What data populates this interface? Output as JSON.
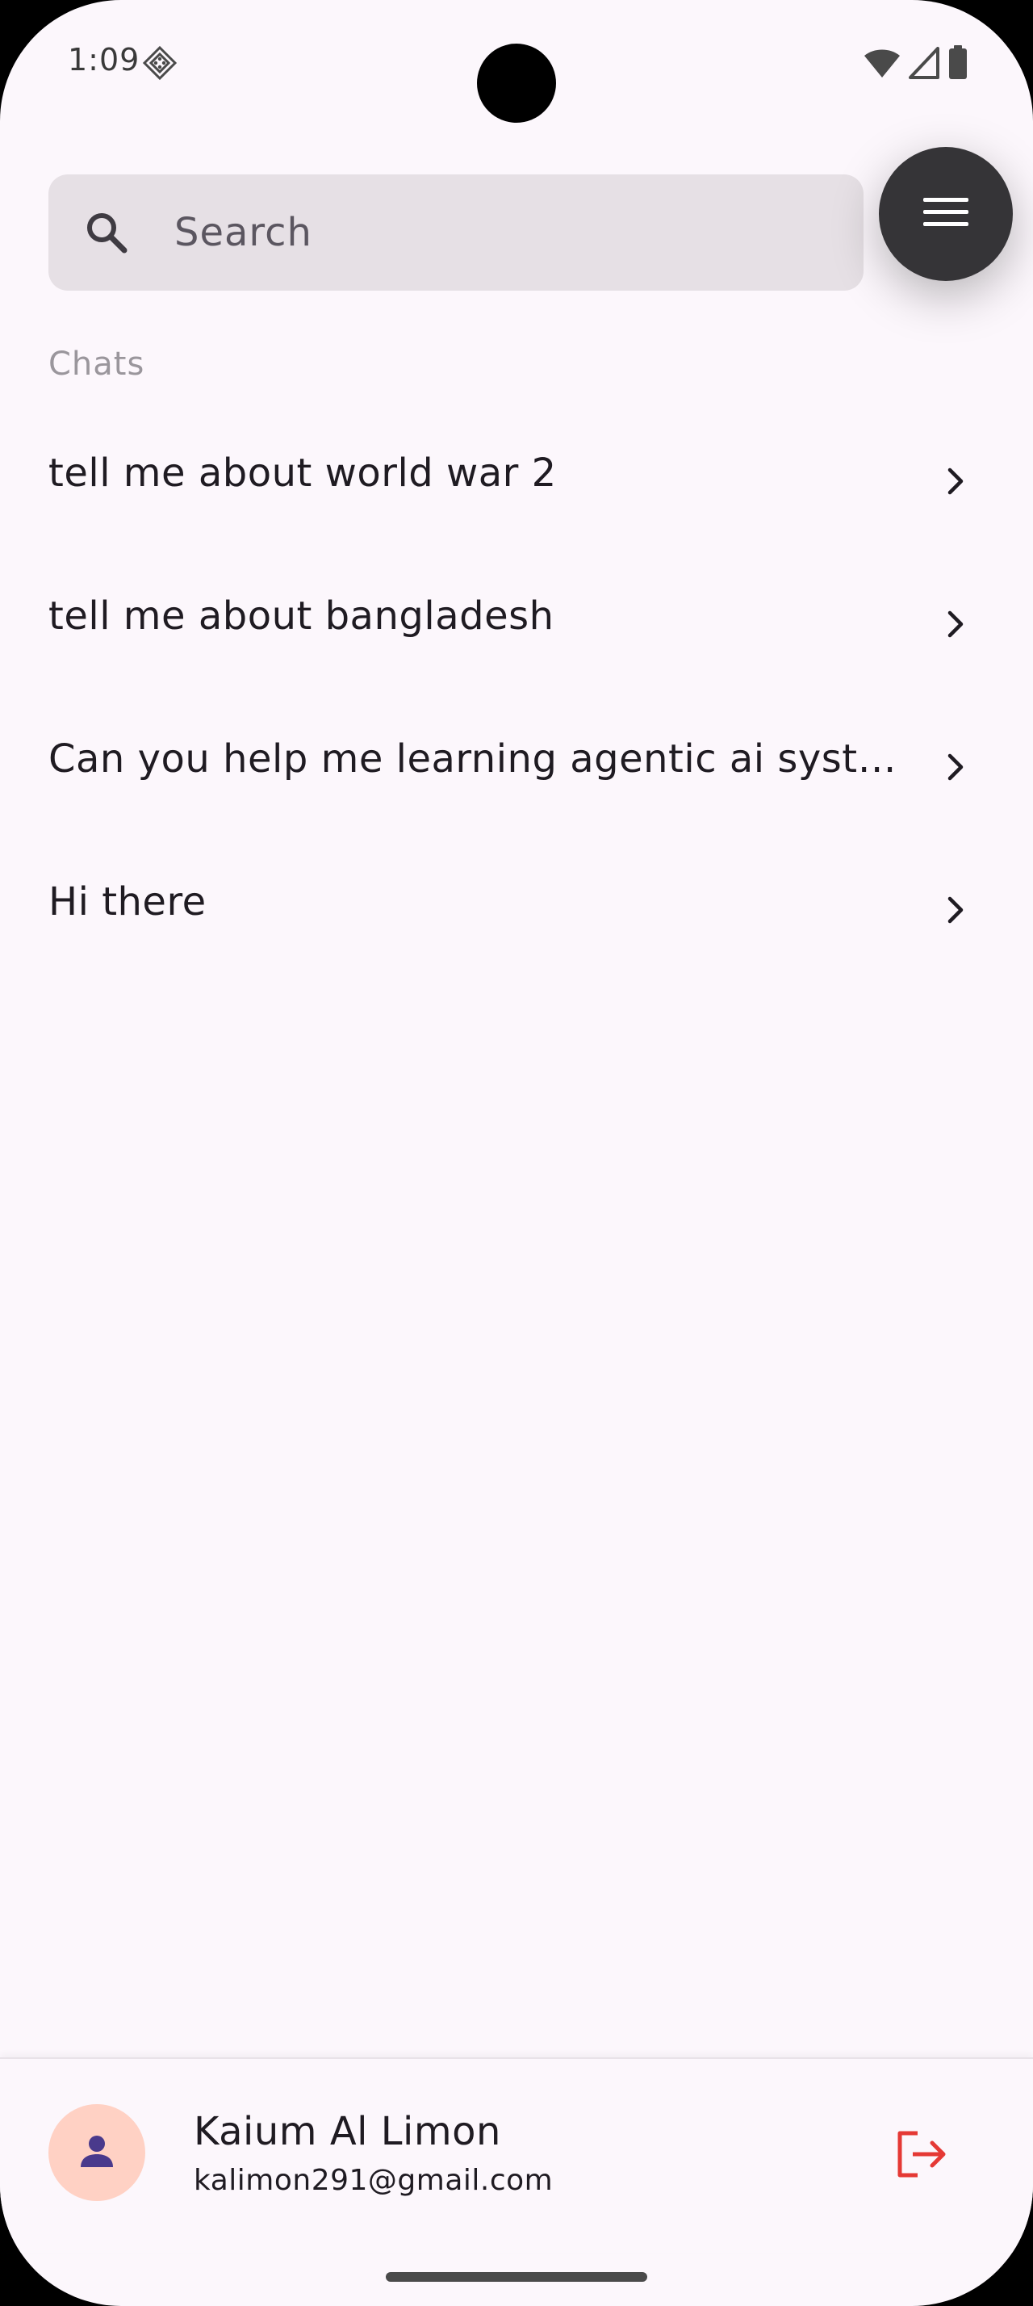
{
  "status_bar": {
    "time": "1:09",
    "icons": [
      "debug-diamond-icon",
      "wifi-icon",
      "cellular-signal-icon",
      "battery-icon"
    ]
  },
  "search": {
    "placeholder": "Search",
    "value": ""
  },
  "menu_button": {
    "icon": "hamburger-menu-icon"
  },
  "chats_section": {
    "label": "Chats",
    "items": [
      {
        "title": "tell me about world war 2"
      },
      {
        "title": "tell me about bangladesh"
      },
      {
        "title": "Can you help me learning agentic ai system"
      },
      {
        "title": "Hi there"
      }
    ]
  },
  "profile": {
    "name": "Kaium Al Limon",
    "email": "kalimon291@gmail.com",
    "logout_icon": "logout-icon"
  },
  "colors": {
    "background": "#fcf7fc",
    "search_bg": "#e6e0e5",
    "fab_bg": "#353437",
    "avatar_bg": "#ffd1c4",
    "avatar_icon": "#4a3a8c",
    "logout_red": "#e53935"
  }
}
